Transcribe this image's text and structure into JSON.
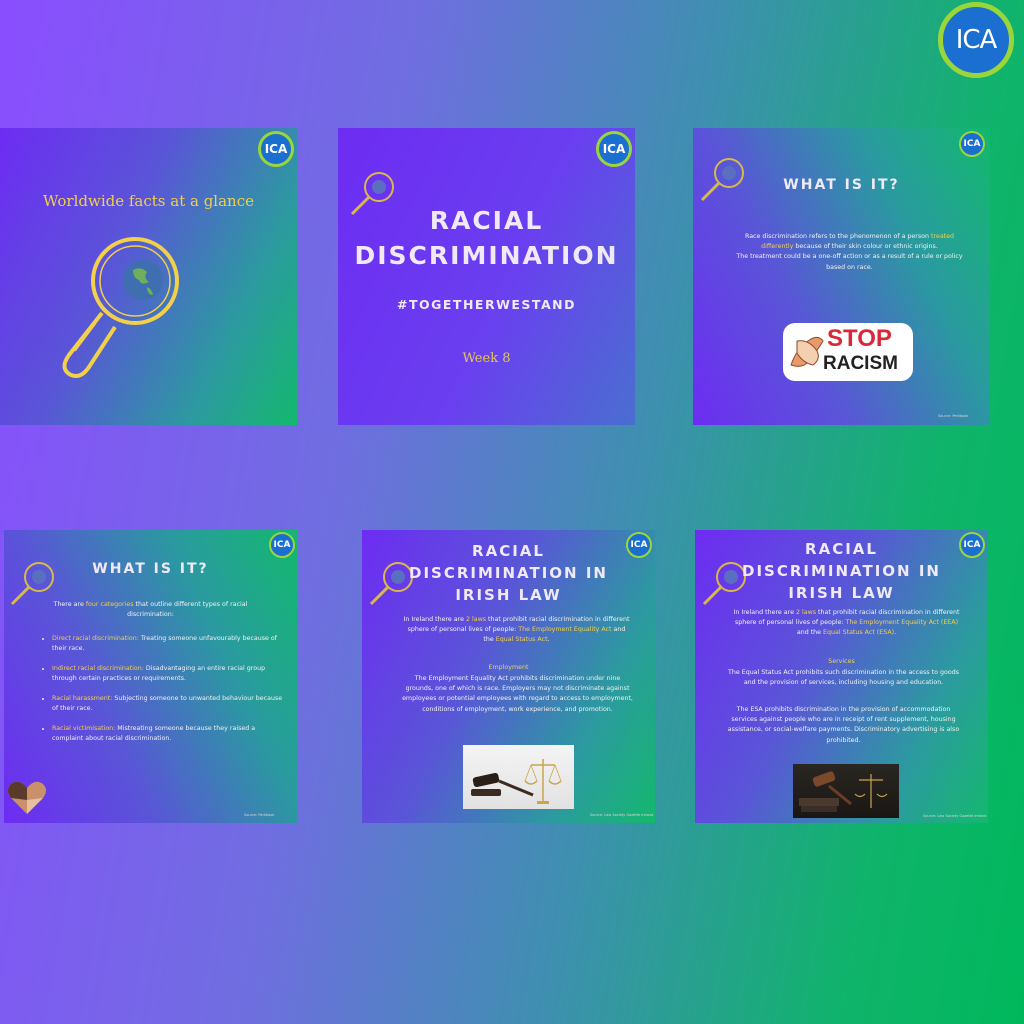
{
  "logo": {
    "text": "ICA"
  },
  "card1": {
    "heading": "Worldwide facts at a glance"
  },
  "card2": {
    "title_line1": "RACIAL",
    "title_line2": "DISCRIMINATION",
    "hashtag": "#TOGETHERWESTAND",
    "week": "Week 8"
  },
  "card3": {
    "title": "WHAT IS IT?",
    "p1_a": "Race discrimination refers to the phenomenon of a person ",
    "p1_hl": "treated differently",
    "p1_b": " because of their skin colour or ethnic origins.",
    "p2": "The treatment could be a one-off action or as a result of a rule or policy based on race.",
    "sticker_line1": "STOP",
    "sticker_line2": "RACISM",
    "source": "Source: Perkbook"
  },
  "card4": {
    "title": "WHAT IS IT?",
    "intro_a": "There are ",
    "intro_hl": "four categories",
    "intro_b": " that outline different types of racial discrimination:",
    "items": [
      {
        "term": "Direct racial discrimination:",
        "desc": " Treating someone unfavourably because of their race."
      },
      {
        "term": "Indirect racial discrimination:",
        "desc": " Disadvantaging an entire racial group through certain practices or requirements."
      },
      {
        "term": "Racial harassment:",
        "desc": " Subjecting someone to unwanted behaviour because of their race."
      },
      {
        "term": "Racial victimisation:",
        "desc": " Mistreating someone because they raised a complaint about racial discrimination."
      }
    ],
    "source": "Source: Perkbook"
  },
  "card5": {
    "title_line1": "RACIAL",
    "title_line2": "DISCRIMINATION IN",
    "title_line3": "IRISH LAW",
    "p1_a": "In Ireland there are ",
    "p1_hl1": "2 laws",
    "p1_b": " that prohibit racial discrimination in different sphere of personal lives of people: ",
    "p1_hl2": "The Employment Equality Act",
    "p1_c": " and the ",
    "p1_hl3": "Equal Status Act",
    "p1_d": ".",
    "subhead": "Employment",
    "p2": "The Employment Equality Act prohibits discrimination under nine grounds, one of which is race. Employers may not discriminate against employees or potential employees with regard to access to employment, conditions of employment, work experience, and promotion.",
    "source": "Source: Law Society Gazette Ireland"
  },
  "card6": {
    "title_line1": "RACIAL",
    "title_line2": "DISCRIMINATION IN",
    "title_line3": "IRISH LAW",
    "p1_a": "In Ireland there are ",
    "p1_hl1": "2 laws",
    "p1_b": " that prohibit racial discrimination in different sphere of personal lives of people: ",
    "p1_hl2": "The Employment Equality Act (EEA)",
    "p1_c": " and the ",
    "p1_hl3": "Equal Status Act (ESA)",
    "p1_d": ".",
    "subhead": "Services",
    "p2": "The Equal Status Act prohibits such discrimination in the access to goods and the provision of services, including housing and education.",
    "p3": "The ESA prohibits discrimination in the provision of accommodation services against people who are in receipt of rent supplement, housing assistance, or social-welfare payments. Discriminatory advertising is also prohibited.",
    "source": "Source: Law Society Gazette Ireland"
  },
  "colors": {
    "accent": "#f2d04a",
    "logo_blue": "#1a6fd0",
    "logo_ring": "#9ad63a"
  }
}
